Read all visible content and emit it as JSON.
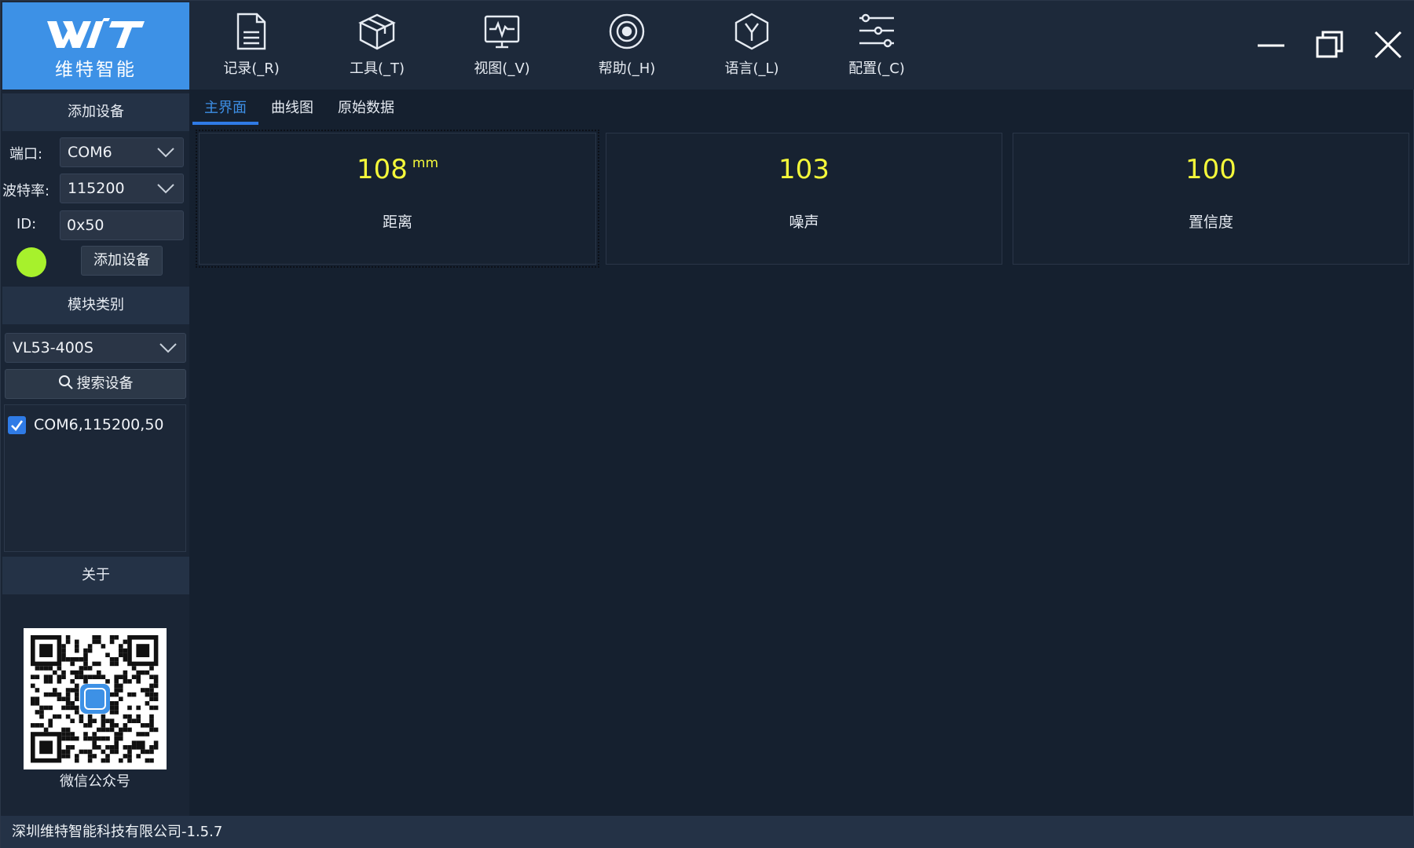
{
  "brand": {
    "logo_text": "WIT",
    "logo_subtitle": "维特智能"
  },
  "toolbar": {
    "items": [
      {
        "label": "记录(_R)",
        "icon": "document-icon"
      },
      {
        "label": "工具(_T)",
        "icon": "box-icon"
      },
      {
        "label": "视图(_V)",
        "icon": "waveform-monitor-icon"
      },
      {
        "label": "帮助(_H)",
        "icon": "target-icon"
      },
      {
        "label": "语言(_L)",
        "icon": "hexagon-y-icon"
      },
      {
        "label": "配置(_C)",
        "icon": "sliders-icon"
      }
    ],
    "window_controls": [
      "minimize-icon",
      "restore-icon",
      "close-icon"
    ]
  },
  "sidebar": {
    "add_device": {
      "header": "添加设备",
      "port_label": "端口:",
      "port_value": "COM6",
      "baud_label": "波特率:",
      "baud_value": "115200",
      "id_label": "ID:",
      "id_value": "0x50",
      "status_color": "#a7f12c",
      "add_button": "添加设备"
    },
    "module": {
      "header": "模块类别",
      "type_value": "VL53-400S",
      "search_button": "搜索设备"
    },
    "devices": [
      {
        "label": "COM6,115200,50",
        "checked": true
      }
    ],
    "about_header": "关于",
    "qr_caption": "微信公众号"
  },
  "main": {
    "tabs": [
      {
        "label": "主界面",
        "active": true
      },
      {
        "label": "曲线图",
        "active": false
      },
      {
        "label": "原始数据",
        "active": false
      }
    ],
    "cards": [
      {
        "value": "108",
        "unit": "mm",
        "label": "距离"
      },
      {
        "value": "103",
        "unit": "",
        "label": "噪声"
      },
      {
        "value": "100",
        "unit": "",
        "label": "置信度"
      }
    ]
  },
  "statusbar": {
    "text": "深圳维特智能科技有限公司-1.5.7"
  },
  "colors": {
    "accent": "#2f7be6",
    "logo_bg": "#3d91e6",
    "value_yellow": "#f4f83a",
    "background": "#15202f"
  }
}
